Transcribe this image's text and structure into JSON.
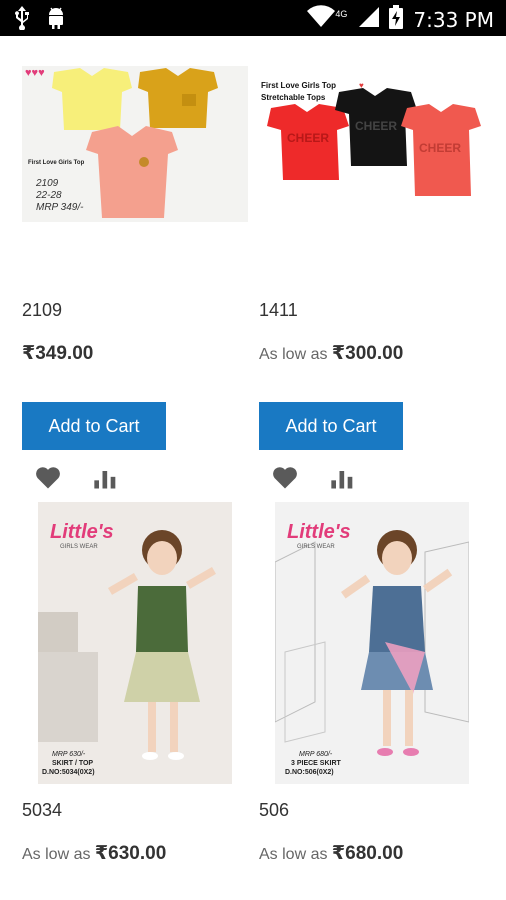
{
  "status_bar": {
    "time": "7:33 PM",
    "icons": [
      "usb-icon",
      "android-icon",
      "wifi-icon",
      "signal-icon",
      "battery-charging-icon"
    ],
    "network_label": "4G"
  },
  "products": [
    {
      "name": "2109",
      "price_label": "",
      "price": "₹349.00",
      "add_to_cart": "Add to Cart",
      "image": {
        "caption": "First Love Girls Top",
        "lines": [
          "2109",
          "22-28",
          "MRP 349/-"
        ],
        "shirt_colors": [
          "#f7ef7a",
          "#d9a21a",
          "#f4a08e"
        ]
      }
    },
    {
      "name": "1411",
      "price_label": "As low as",
      "price": "₹300.00",
      "add_to_cart": "Add to Cart",
      "image": {
        "caption": "First Love Girls Top",
        "caption2": "Stretchable Tops",
        "shirt_text": "CHEER",
        "shirt_colors": [
          "#ee2a2a",
          "#141414",
          "#f0594f"
        ]
      }
    },
    {
      "name": "5034",
      "price_label": "As low as",
      "price": "₹630.00",
      "image": {
        "brand": "Little's",
        "brand_sub": "GIRLS WEAR",
        "lines": [
          "MRP 630/-",
          "SKIRT / TOP",
          "D.NO:5034(0X2)"
        ]
      }
    },
    {
      "name": "506",
      "price_label": "As low as",
      "price": "₹680.00",
      "image": {
        "brand": "Little's",
        "brand_sub": "GIRLS WEAR",
        "lines": [
          "MRP 680/-",
          "3 PIECE SKIRT",
          "D.NO:506(0X2)"
        ]
      }
    }
  ],
  "colors": {
    "button": "#1979c3",
    "text": "#333333",
    "muted": "#666666"
  }
}
